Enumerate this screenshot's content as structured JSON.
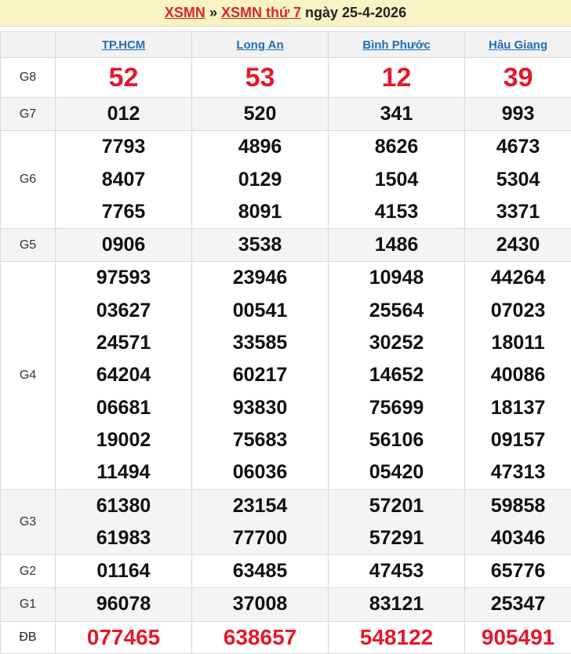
{
  "header": {
    "link1": "XSMN",
    "separator": "»",
    "link2": "XSMN thứ 7",
    "date_text": "ngày 25-4-2026"
  },
  "provinces": [
    "TP.HCM",
    "Long An",
    "Bình Phước",
    "Hậu Giang"
  ],
  "prizes": [
    {
      "label": "G8",
      "numbers": [
        [
          "52"
        ],
        [
          "53"
        ],
        [
          "12"
        ],
        [
          "39"
        ]
      ]
    },
    {
      "label": "G7",
      "numbers": [
        [
          "012"
        ],
        [
          "520"
        ],
        [
          "341"
        ],
        [
          "993"
        ]
      ]
    },
    {
      "label": "G6",
      "numbers": [
        [
          "7793",
          "8407",
          "7765"
        ],
        [
          "4896",
          "0129",
          "8091"
        ],
        [
          "8626",
          "1504",
          "4153"
        ],
        [
          "4673",
          "5304",
          "3371"
        ]
      ]
    },
    {
      "label": "G5",
      "numbers": [
        [
          "0906"
        ],
        [
          "3538"
        ],
        [
          "1486"
        ],
        [
          "2430"
        ]
      ]
    },
    {
      "label": "G4",
      "numbers": [
        [
          "97593",
          "03627",
          "24571",
          "64204",
          "06681",
          "19002",
          "11494"
        ],
        [
          "23946",
          "00541",
          "33585",
          "60217",
          "93830",
          "75683",
          "06036"
        ],
        [
          "10948",
          "25564",
          "30252",
          "14652",
          "75699",
          "56106",
          "05420"
        ],
        [
          "44264",
          "07023",
          "18011",
          "40086",
          "18137",
          "09157",
          "47313"
        ]
      ]
    },
    {
      "label": "G3",
      "numbers": [
        [
          "61380",
          "61983"
        ],
        [
          "23154",
          "77700"
        ],
        [
          "57201",
          "57291"
        ],
        [
          "59858",
          "40346"
        ]
      ]
    },
    {
      "label": "G2",
      "numbers": [
        [
          "01164"
        ],
        [
          "63485"
        ],
        [
          "47453"
        ],
        [
          "65776"
        ]
      ]
    },
    {
      "label": "G1",
      "numbers": [
        [
          "96078"
        ],
        [
          "37008"
        ],
        [
          "83121"
        ],
        [
          "25347"
        ]
      ]
    },
    {
      "label": "ĐB",
      "numbers": [
        [
          "077465"
        ],
        [
          "638657"
        ],
        [
          "548122"
        ],
        [
          "905491"
        ]
      ]
    }
  ],
  "colors": {
    "accent_red": "#e3192b",
    "link_blue": "#1f6fb8",
    "header_bg": "#f7f3c4"
  }
}
